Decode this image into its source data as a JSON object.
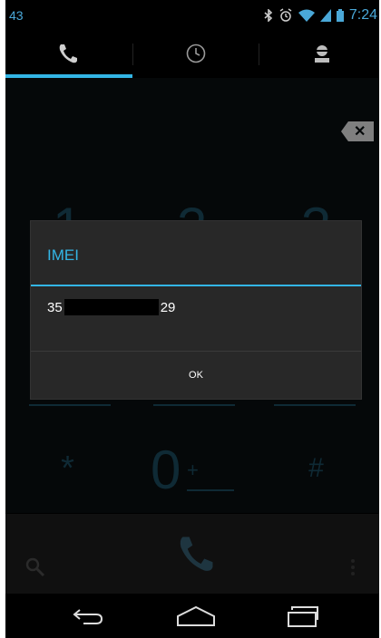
{
  "statusbar": {
    "notification_count": "43",
    "time": "7:24"
  },
  "tabs": [
    {
      "icon": "phone-icon"
    },
    {
      "icon": "clock-icon"
    },
    {
      "icon": "contacts-icon"
    }
  ],
  "dialpad": {
    "row1": [
      "1",
      "2",
      "3"
    ],
    "zero_row": {
      "star": "*",
      "zero": "0",
      "plus": "+",
      "hash": "#"
    }
  },
  "dialog": {
    "title": "IMEI",
    "imei_prefix": "35",
    "imei_suffix": "29",
    "ok_label": "OK"
  },
  "colors": {
    "accent": "#33b5e5",
    "dialog_bg": "#282828"
  }
}
